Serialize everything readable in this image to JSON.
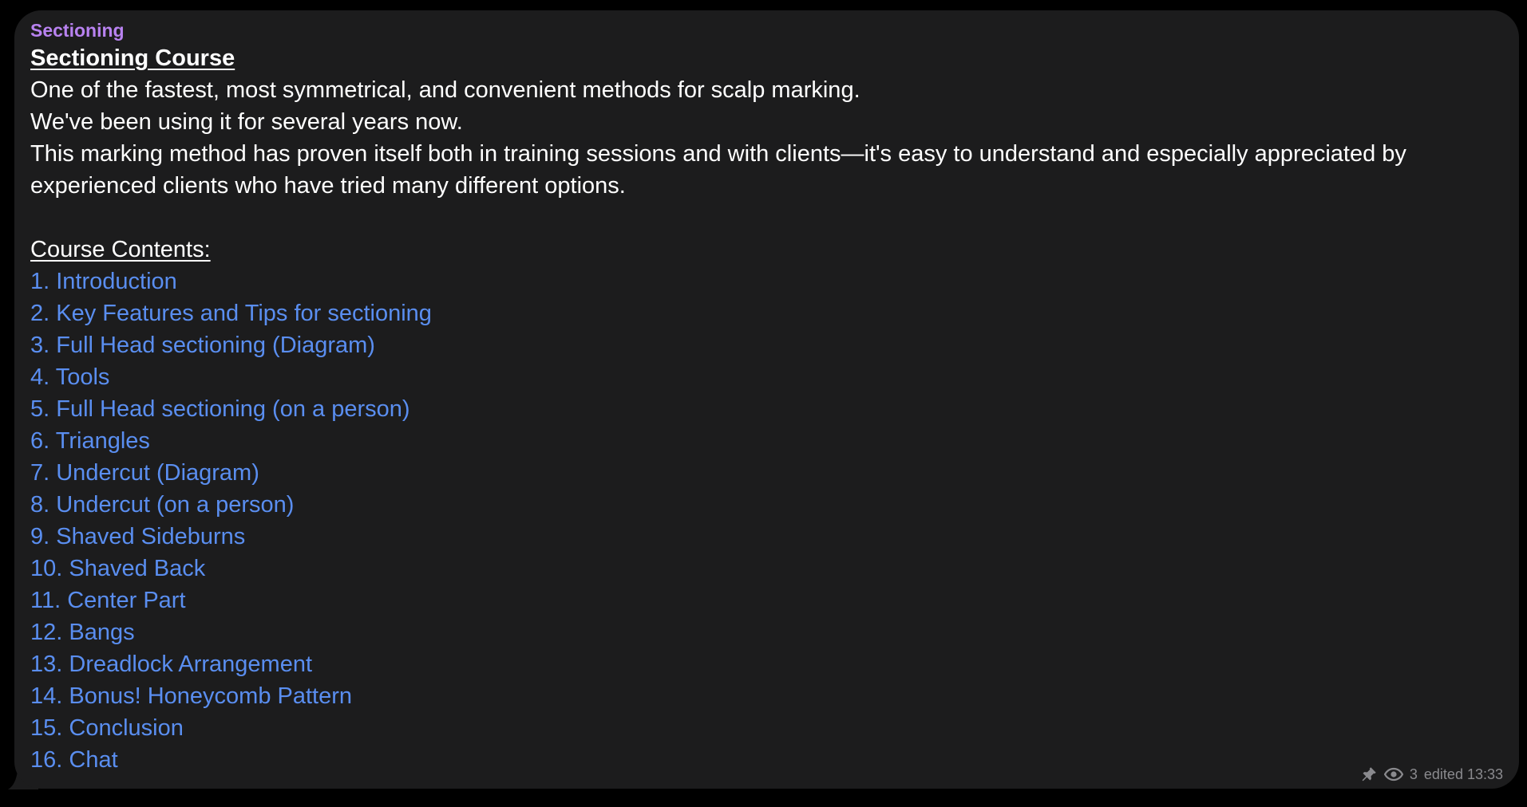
{
  "message": {
    "sender": "Sectioning",
    "title": "Sectioning Course",
    "paragraphs": [
      "One of the fastest, most symmetrical, and convenient methods for scalp marking.",
      "We've been using it for several years now.",
      "This marking method has proven itself both in training sessions and with clients—it's easy to understand and especially appreciated by",
      "experienced clients who have tried many different options."
    ],
    "contents_heading": "Course Contents:",
    "contents": [
      "1. Introduction",
      "2. Key Features and Tips for sectioning",
      "3. Full Head sectioning (Diagram)",
      "4. Tools",
      "5. Full Head sectioning (on a person)",
      "6. Triangles",
      "7. Undercut (Diagram)",
      "8. Undercut (on a person)",
      "9. Shaved Sideburns",
      "10. Shaved Back",
      "11. Center Part",
      "12. Bangs",
      "13. Dreadlock Arrangement",
      "14. Bonus! Honeycomb Pattern",
      "15. Conclusion",
      "16. Chat"
    ],
    "meta": {
      "pin_icon": "pin-icon",
      "views_icon": "eye-icon",
      "views": "3",
      "edited_time": "edited 13:33"
    }
  },
  "colors": {
    "background": "#000000",
    "bubble": "#1c1c1d",
    "sender": "#b882f0",
    "text": "#ffffff",
    "link": "#5a8ef0",
    "meta": "#8a8a8e"
  }
}
